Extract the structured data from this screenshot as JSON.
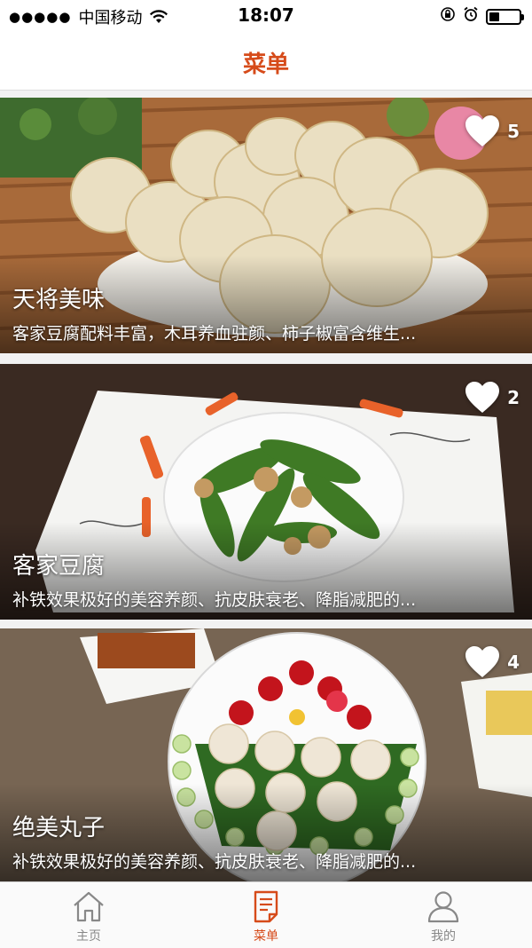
{
  "status_bar": {
    "signal": "●●●●●",
    "carrier": "中国移动",
    "time": "18:07",
    "battery_level": 0.35
  },
  "nav": {
    "title": "菜单"
  },
  "cards": [
    {
      "title": "天将美味",
      "description": "客家豆腐配料丰富，木耳养血驻颜、柿子椒富含维生...",
      "likes": "5",
      "theme": "pastry"
    },
    {
      "title": "客家豆腐",
      "description": "补铁效果极好的美容养颜、抗皮肤衰老、降脂减肥的...",
      "likes": "2",
      "theme": "stirfry"
    },
    {
      "title": "绝美丸子",
      "description": "补铁效果极好的美容养颜、抗皮肤衰老、降脂减肥的...",
      "likes": "4",
      "theme": "meatball"
    }
  ],
  "tabs": [
    {
      "label": "主页",
      "icon": "home-icon",
      "active": false
    },
    {
      "label": "菜单",
      "icon": "menu-document-icon",
      "active": true
    },
    {
      "label": "我的",
      "icon": "user-icon",
      "active": false
    }
  ],
  "colors": {
    "accent": "#d64b1a",
    "inactive": "#888888"
  }
}
